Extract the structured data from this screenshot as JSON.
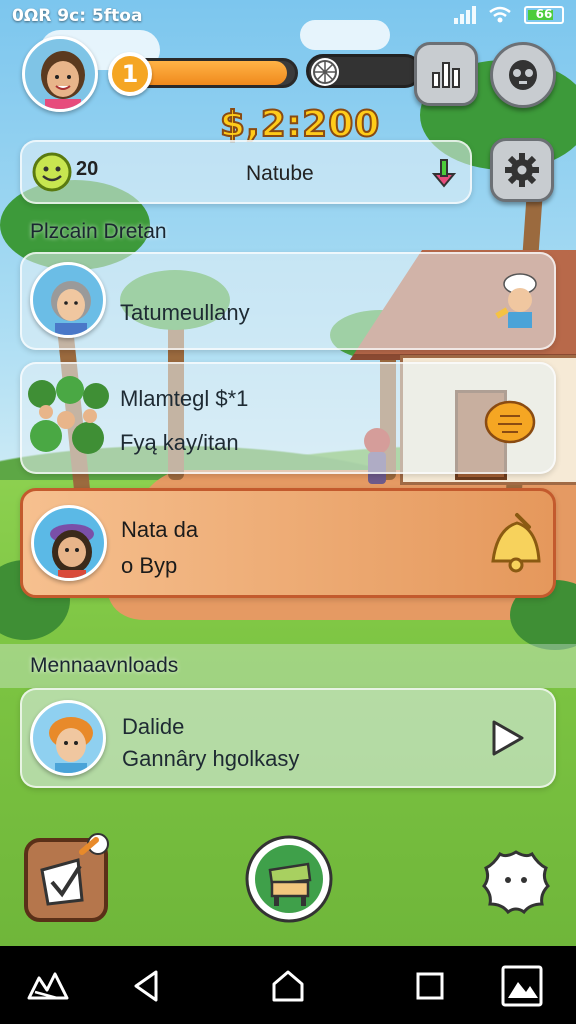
{
  "status_bar": {
    "time_text": "0ΩR 9c: 5ftoa",
    "battery_text": "66"
  },
  "hud": {
    "level": "1",
    "level_progress": 0.95,
    "energy_progress": 0.15,
    "money": "$,2:200",
    "currency_count": "20",
    "center_label": "Natube"
  },
  "sections": {
    "section1_label": "Plzcain  Dretan",
    "section2_label": "Mennaavnloads"
  },
  "cards": [
    {
      "line1": "Tatumeullany",
      "line2": ""
    },
    {
      "line1": "Mlamtegl  $*1",
      "line2": "Fyą kay/itan"
    },
    {
      "line1": "Nata da",
      "line2": "o Byp"
    },
    {
      "line1": "Dalide",
      "line2": "Gannâry hgolkasy"
    }
  ],
  "icons": {
    "stats": "bar-chart-icon",
    "profile": "alien-face-icon",
    "settings": "gear-icon",
    "download": "download-arrow-icon",
    "play": "play-icon"
  },
  "colors": {
    "accent_orange": "#f08a1c",
    "money_yellow": "#ffcc1a",
    "card_highlight": "#e5985c"
  }
}
